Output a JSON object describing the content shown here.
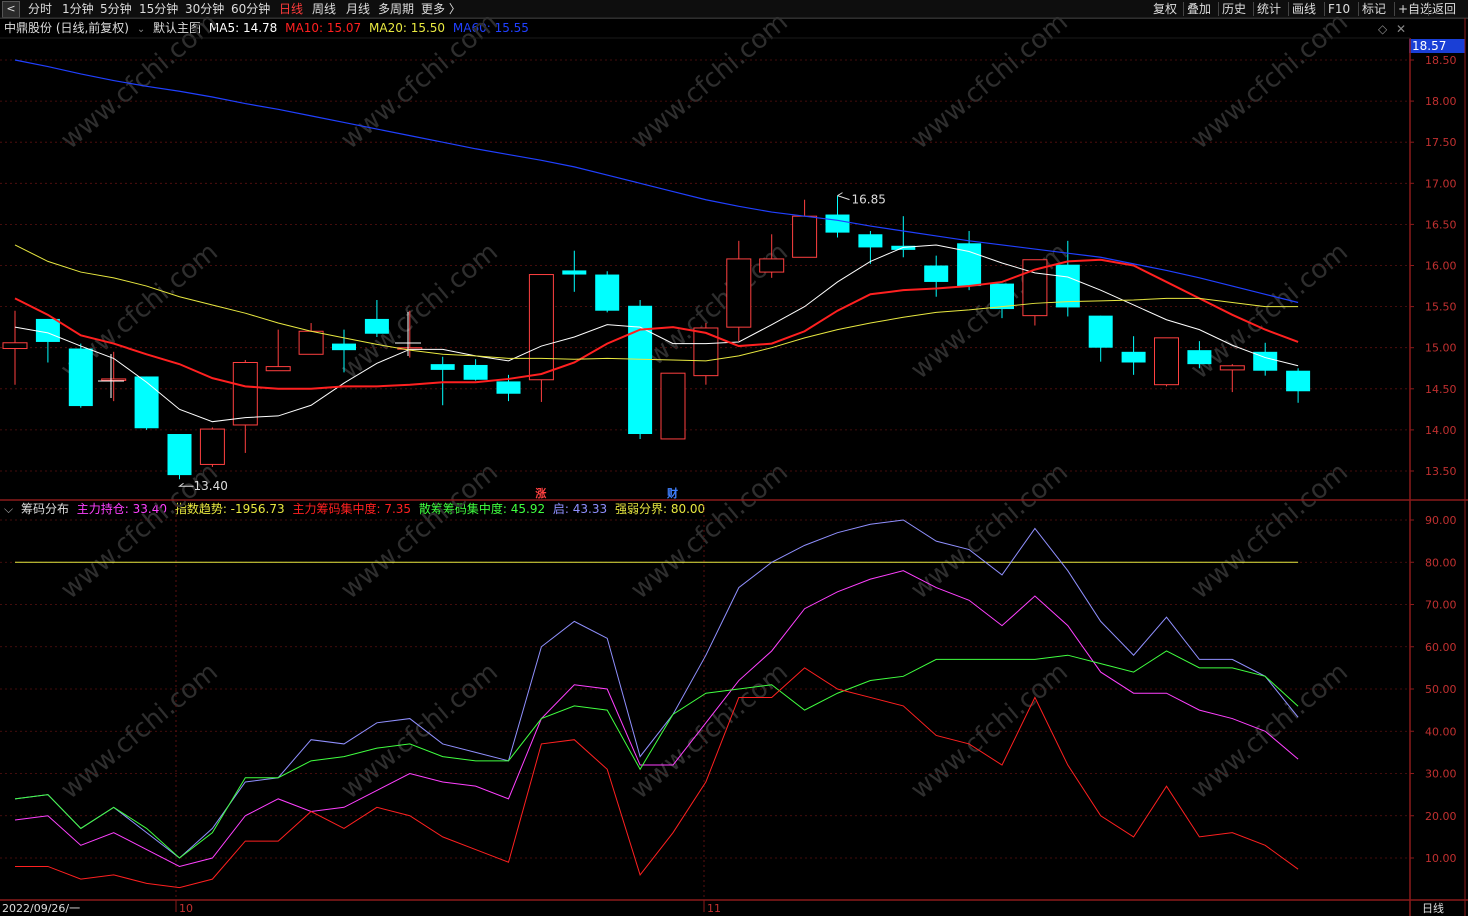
{
  "toolbar": {
    "back_label": "<",
    "periods": [
      "分时",
      "1分钟",
      "5分钟",
      "15分钟",
      "30分钟",
      "60分钟",
      "日线",
      "周线",
      "月线",
      "多周期",
      "更多 〉"
    ],
    "active_period": "日线",
    "right_items": [
      "复权",
      "叠加",
      "历史",
      "统计",
      "画线",
      "F10",
      "标记",
      "+自选",
      "返回"
    ]
  },
  "main_info": {
    "stock": "中鼎股份 (日线,前复权)",
    "template": "默认主图",
    "ma5": "MA5: 14.78",
    "ma10": "MA10: 15.07",
    "ma20": "MA20: 15.50",
    "ma60": "MA60: 15.55"
  },
  "indicator_info": {
    "name": "筹码分布",
    "main_hold": "主力持仓: 33.40",
    "index_trend": "指数趋势: -1956.73",
    "main_conc": "主力筹码集中度: 7.35",
    "retail_conc": "散筹筹码集中度: 45.92",
    "qi": "启: 43.33",
    "boundary": "强弱分界: 80.00"
  },
  "current_price": "18.57",
  "date_label": "2022/09/26/一",
  "period_label": "日线",
  "watermark": "www.cfchi.com",
  "colors": {
    "up": "#ff4040",
    "down": "#00ffff",
    "ma5": "#ffffff",
    "ma10": "#ff2020",
    "ma20": "#e8e840",
    "ma60": "#2040ff",
    "main_hold": "#ff40ff",
    "index_trend": "#e8e840",
    "main_conc": "#ff2020",
    "retail_conc": "#40ff40",
    "qi": "#9090ff",
    "boundary": "#e8e840"
  },
  "chart_data": [
    {
      "type": "candlestick",
      "y_axis": {
        "min": 13.5,
        "max": 18.5,
        "ticks": [
          "13.50",
          "14.00",
          "14.50",
          "15.00",
          "15.50",
          "16.00",
          "16.50",
          "17.00",
          "17.50",
          "18.00",
          "18.50"
        ]
      },
      "x_labels": [
        "10",
        "11"
      ],
      "candles": [
        {
          "o": 14.99,
          "c": 15.06,
          "h": 15.45,
          "l": 14.55
        },
        {
          "o": 15.35,
          "c": 15.07,
          "h": 15.35,
          "l": 14.82
        },
        {
          "o": 14.99,
          "c": 14.29,
          "h": 15.05,
          "l": 14.27
        },
        {
          "o": 14.62,
          "c": 14.62,
          "h": 14.95,
          "l": 14.35
        },
        {
          "o": 14.65,
          "c": 14.02,
          "h": 14.65,
          "l": 14.0
        },
        {
          "o": 13.95,
          "c": 13.45,
          "h": 13.95,
          "l": 13.4
        },
        {
          "o": 13.58,
          "c": 14.01,
          "h": 14.03,
          "l": 13.55
        },
        {
          "o": 14.06,
          "c": 14.82,
          "h": 14.85,
          "l": 13.72
        },
        {
          "o": 14.72,
          "c": 14.77,
          "h": 15.22,
          "l": 14.72
        },
        {
          "o": 14.92,
          "c": 15.2,
          "h": 15.3,
          "l": 14.92
        },
        {
          "o": 15.05,
          "c": 14.97,
          "h": 15.22,
          "l": 14.7
        },
        {
          "o": 15.35,
          "c": 15.17,
          "h": 15.58,
          "l": 15.13
        },
        {
          "o": 15.0,
          "c": 15.0,
          "h": 15.45,
          "l": 14.88
        },
        {
          "o": 14.8,
          "c": 14.73,
          "h": 14.89,
          "l": 14.3
        },
        {
          "o": 14.79,
          "c": 14.61,
          "h": 14.86,
          "l": 14.6
        },
        {
          "o": 14.59,
          "c": 14.44,
          "h": 14.67,
          "l": 14.35
        },
        {
          "o": 14.61,
          "c": 15.89,
          "h": 15.89,
          "l": 14.34
        },
        {
          "o": 15.94,
          "c": 15.89,
          "h": 16.18,
          "l": 15.68
        },
        {
          "o": 15.89,
          "c": 15.45,
          "h": 15.93,
          "l": 15.43
        },
        {
          "o": 15.51,
          "c": 13.95,
          "h": 15.58,
          "l": 13.89
        },
        {
          "o": 13.89,
          "c": 14.69,
          "h": 14.69,
          "l": 13.89
        },
        {
          "o": 14.66,
          "c": 15.24,
          "h": 15.3,
          "l": 14.55
        },
        {
          "o": 15.25,
          "c": 16.08,
          "h": 16.3,
          "l": 15.08
        },
        {
          "o": 15.92,
          "c": 16.08,
          "h": 16.38,
          "l": 15.85
        },
        {
          "o": 16.1,
          "c": 16.6,
          "h": 16.8,
          "l": 16.1
        },
        {
          "o": 16.62,
          "c": 16.4,
          "h": 16.85,
          "l": 16.34
        },
        {
          "o": 16.38,
          "c": 16.22,
          "h": 16.42,
          "l": 16.02
        },
        {
          "o": 16.24,
          "c": 16.19,
          "h": 16.6,
          "l": 16.1
        },
        {
          "o": 16.0,
          "c": 15.8,
          "h": 16.12,
          "l": 15.62
        },
        {
          "o": 16.27,
          "c": 15.75,
          "h": 16.42,
          "l": 15.7
        },
        {
          "o": 15.78,
          "c": 15.47,
          "h": 15.78,
          "l": 15.36
        },
        {
          "o": 15.39,
          "c": 16.07,
          "h": 16.07,
          "l": 15.27
        },
        {
          "o": 16.01,
          "c": 15.49,
          "h": 16.3,
          "l": 15.38
        },
        {
          "o": 15.39,
          "c": 15.0,
          "h": 15.39,
          "l": 14.83
        },
        {
          "o": 14.95,
          "c": 14.82,
          "h": 15.14,
          "l": 14.67
        },
        {
          "o": 14.55,
          "c": 15.12,
          "h": 15.12,
          "l": 14.53
        },
        {
          "o": 14.97,
          "c": 14.8,
          "h": 15.08,
          "l": 14.75
        },
        {
          "o": 14.73,
          "c": 14.78,
          "h": 14.8,
          "l": 14.46
        },
        {
          "o": 14.95,
          "c": 14.72,
          "h": 15.06,
          "l": 14.66
        },
        {
          "o": 14.72,
          "c": 14.47,
          "h": 14.75,
          "l": 14.33
        }
      ],
      "series": [
        {
          "name": "MA5",
          "values": [
            15.25,
            15.18,
            15.02,
            14.87,
            14.58,
            14.25,
            14.1,
            14.15,
            14.17,
            14.3,
            14.57,
            14.81,
            14.98,
            14.98,
            14.9,
            14.84,
            15.02,
            15.13,
            15.28,
            15.25,
            15.05,
            15.05,
            15.07,
            15.28,
            15.5,
            15.8,
            16.05,
            16.22,
            16.25,
            16.17,
            16.03,
            15.91,
            15.86,
            15.7,
            15.52,
            15.34,
            15.22,
            15.03,
            14.88,
            14.78
          ]
        },
        {
          "name": "MA10",
          "values": [
            15.6,
            15.4,
            15.15,
            15.05,
            14.92,
            14.8,
            14.63,
            14.53,
            14.5,
            14.5,
            14.53,
            14.53,
            14.55,
            14.58,
            14.58,
            14.62,
            14.68,
            14.82,
            15.05,
            15.22,
            15.25,
            15.18,
            15.02,
            15.05,
            15.2,
            15.45,
            15.65,
            15.7,
            15.72,
            15.75,
            15.8,
            15.95,
            16.05,
            16.07,
            16.0,
            15.8,
            15.6,
            15.4,
            15.22,
            15.07
          ]
        },
        {
          "name": "MA20",
          "values": [
            16.25,
            16.05,
            15.92,
            15.85,
            15.75,
            15.62,
            15.52,
            15.42,
            15.3,
            15.2,
            15.12,
            15.04,
            14.97,
            14.92,
            14.9,
            14.87,
            14.87,
            14.86,
            14.87,
            14.86,
            14.85,
            14.84,
            14.9,
            15.0,
            15.12,
            15.22,
            15.3,
            15.37,
            15.43,
            15.46,
            15.5,
            15.54,
            15.56,
            15.57,
            15.58,
            15.6,
            15.6,
            15.55,
            15.5,
            15.5
          ]
        },
        {
          "name": "MA60",
          "values": [
            18.5,
            18.42,
            18.33,
            18.25,
            18.18,
            18.12,
            18.05,
            17.97,
            17.9,
            17.82,
            17.74,
            17.66,
            17.58,
            17.5,
            17.42,
            17.35,
            17.28,
            17.2,
            17.1,
            17.0,
            16.9,
            16.8,
            16.72,
            16.65,
            16.6,
            16.55,
            16.48,
            16.42,
            16.36,
            16.3,
            16.25,
            16.2,
            16.15,
            16.1,
            16.02,
            15.94,
            15.85,
            15.75,
            15.65,
            15.55
          ]
        }
      ],
      "annotations": [
        {
          "text": "16.85",
          "candle": 25,
          "value": 16.85
        },
        {
          "text": "13.40",
          "candle": 5,
          "value": 13.4
        }
      ],
      "markers": [
        {
          "text": "涨",
          "candle": 16
        },
        {
          "text": "财",
          "candle": 20
        }
      ]
    },
    {
      "type": "line",
      "title": "筹码分布",
      "y_axis": {
        "min": 10,
        "max": 90,
        "ticks": [
          "10.00",
          "20.00",
          "30.00",
          "40.00",
          "50.00",
          "60.00",
          "70.00",
          "80.00",
          "90.00"
        ]
      },
      "series": [
        {
          "name": "强弱分界",
          "values": [
            80,
            80,
            80,
            80,
            80,
            80,
            80,
            80,
            80,
            80,
            80,
            80,
            80,
            80,
            80,
            80,
            80,
            80,
            80,
            80,
            80,
            80,
            80,
            80,
            80,
            80,
            80,
            80,
            80,
            80,
            80,
            80,
            80,
            80,
            80,
            80,
            80,
            80,
            80,
            80
          ]
        },
        {
          "name": "启",
          "values": [
            24,
            25,
            17,
            22,
            16,
            10,
            17,
            28,
            29,
            38,
            37,
            42,
            43,
            37,
            35,
            33,
            60,
            66,
            62,
            34,
            44,
            58,
            74,
            80,
            84,
            87,
            89,
            90,
            85,
            83,
            77,
            88,
            78,
            66,
            58,
            67,
            57,
            57,
            53,
            43.33
          ]
        },
        {
          "name": "主力持仓",
          "values": [
            19,
            20,
            13,
            16,
            12,
            8,
            10,
            20,
            24,
            21,
            22,
            26,
            30,
            28,
            27,
            24,
            43,
            51,
            50,
            32,
            32,
            42,
            52,
            59,
            69,
            73,
            76,
            78,
            74,
            71,
            65,
            72,
            65,
            54,
            49,
            49,
            45,
            43,
            40,
            33.4
          ]
        },
        {
          "name": "散筹筹码集中度",
          "values": [
            24,
            25,
            17,
            22,
            17,
            10,
            16,
            29,
            29,
            33,
            34,
            36,
            37,
            34,
            33,
            33,
            43,
            46,
            45,
            31,
            44,
            49,
            50,
            51,
            45,
            49,
            52,
            53,
            57,
            57,
            57,
            57,
            58,
            56,
            54,
            59,
            55,
            55,
            53,
            45.92
          ]
        },
        {
          "name": "主力筹码集中度",
          "values": [
            8,
            8,
            5,
            6,
            4,
            3,
            5,
            14,
            14,
            21,
            17,
            22,
            20,
            15,
            12,
            9,
            37,
            38,
            31,
            6,
            16,
            28,
            48,
            48,
            55,
            50,
            48,
            46,
            39,
            37,
            32,
            48,
            32,
            20,
            15,
            27,
            15,
            16,
            13,
            7.35
          ]
        }
      ]
    }
  ]
}
